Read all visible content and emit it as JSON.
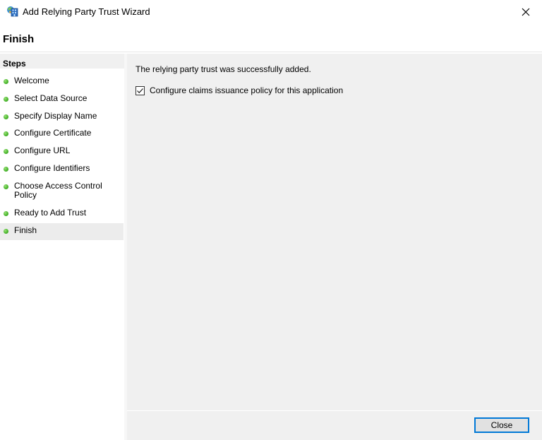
{
  "window": {
    "title": "Add Relying Party Trust Wizard",
    "icon": "relying-party-wizard-icon",
    "close_icon": "close-icon"
  },
  "page": {
    "title": "Finish"
  },
  "steps": {
    "heading": "Steps",
    "items": [
      {
        "label": "Welcome",
        "status": "complete",
        "current": false
      },
      {
        "label": "Select Data Source",
        "status": "complete",
        "current": false
      },
      {
        "label": "Specify Display Name",
        "status": "complete",
        "current": false
      },
      {
        "label": "Configure Certificate",
        "status": "complete",
        "current": false
      },
      {
        "label": "Configure URL",
        "status": "complete",
        "current": false
      },
      {
        "label": "Configure Identifiers",
        "status": "complete",
        "current": false
      },
      {
        "label": "Choose Access Control Policy",
        "status": "complete",
        "current": false
      },
      {
        "label": "Ready to Add Trust",
        "status": "complete",
        "current": false
      },
      {
        "label": "Finish",
        "status": "complete",
        "current": true
      }
    ],
    "status_color": "#4cb82f"
  },
  "content": {
    "message": "The relying party trust was successfully added.",
    "checkbox": {
      "label": "Configure claims issuance policy for this application",
      "checked": true
    }
  },
  "footer": {
    "close_label": "Close",
    "accent_color": "#0078d7"
  }
}
